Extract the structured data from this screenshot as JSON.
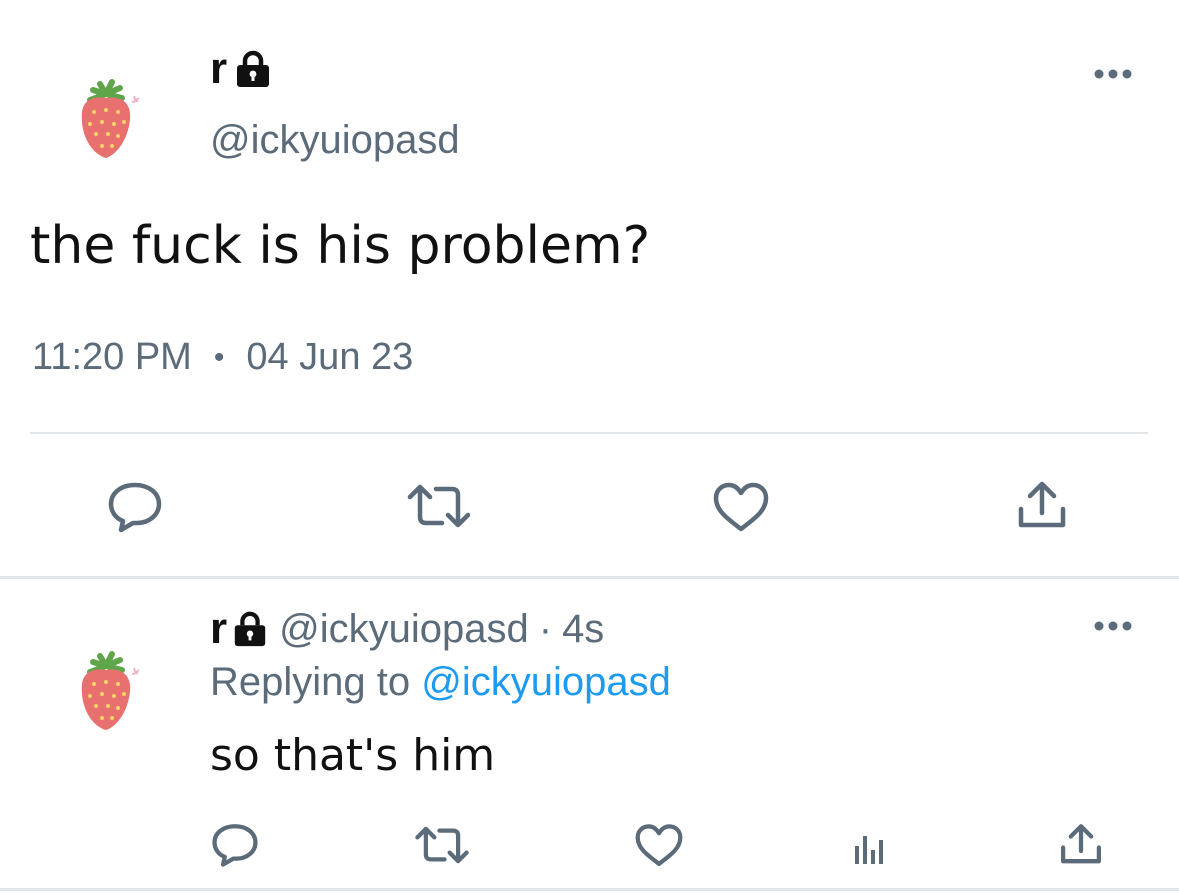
{
  "main_tweet": {
    "display_name": "r",
    "handle": "@ickyuiopasd",
    "text": "the fuck is his problem?",
    "time": "11:20 PM",
    "separator": "•",
    "date": "04 Jun 23",
    "icons": {
      "avatar": "strawberry-avatar",
      "lock": "lock-icon",
      "more": "more-icon",
      "reply": "reply-icon",
      "retweet": "retweet-icon",
      "like": "heart-icon",
      "share": "share-icon"
    }
  },
  "reply_tweet": {
    "display_name": "r",
    "handle": "@ickyuiopasd",
    "separator": "·",
    "age": "4s",
    "replying_prefix": "Replying to",
    "replying_to": "@ickyuiopasd",
    "text": "so that's him",
    "icons": {
      "avatar": "strawberry-avatar",
      "lock": "lock-icon",
      "more": "more-icon",
      "reply": "reply-icon",
      "retweet": "retweet-icon",
      "like": "heart-icon",
      "analytics": "analytics-icon",
      "share": "share-icon"
    }
  },
  "colors": {
    "text": "#111111",
    "secondary": "#5b6b79",
    "link": "#1d9bf0",
    "divider": "#e3e6e9",
    "strawberry": "#e8706e",
    "leaf": "#5fa54a"
  }
}
